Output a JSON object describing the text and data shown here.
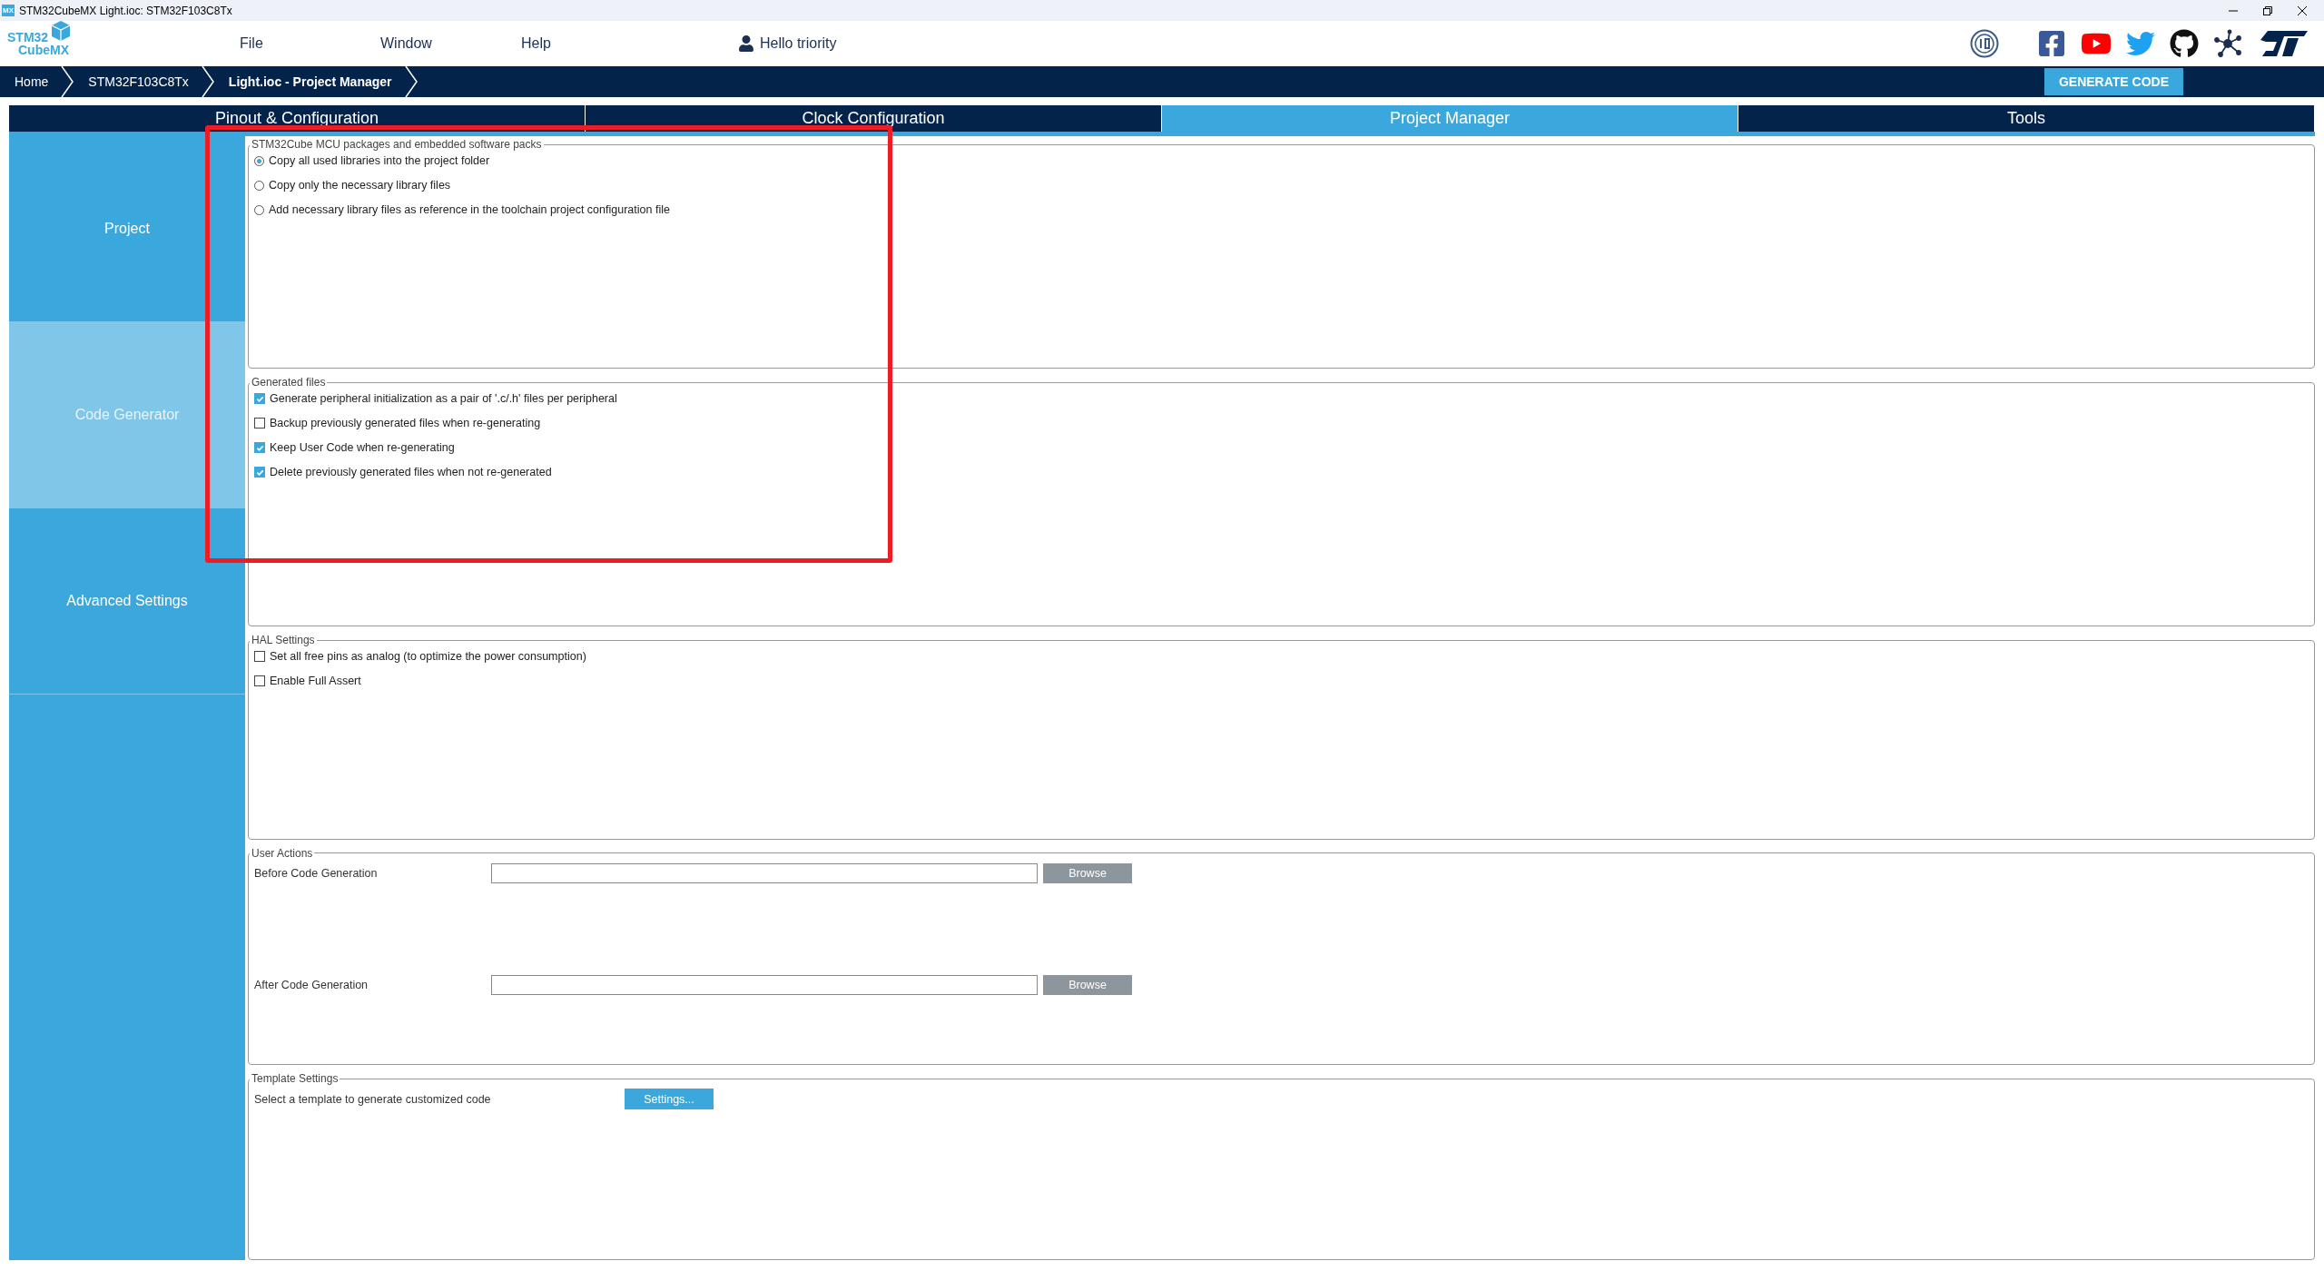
{
  "window": {
    "title": "STM32CubeMX Light.ioc: STM32F103C8Tx",
    "app_badge": "MX"
  },
  "logo": {
    "line1": "STM32",
    "line2": "CubeMX"
  },
  "menu": [
    {
      "label": "File"
    },
    {
      "label": "Window"
    },
    {
      "label": "Help"
    }
  ],
  "user": {
    "label": "Hello triority"
  },
  "breadcrumb": [
    {
      "label": "Home",
      "current": false
    },
    {
      "label": "STM32F103C8Tx",
      "current": false
    },
    {
      "label": "Light.ioc - Project Manager",
      "current": true
    }
  ],
  "generate_button": "GENERATE CODE",
  "tabs": [
    {
      "label": "Pinout & Configuration",
      "selected": false
    },
    {
      "label": "Clock Configuration",
      "selected": false
    },
    {
      "label": "Project Manager",
      "selected": true
    },
    {
      "label": "Tools",
      "selected": false
    }
  ],
  "sidebar": {
    "items": [
      {
        "label": "Project",
        "selected": false
      },
      {
        "label": "Code Generator",
        "selected": true
      },
      {
        "label": "Advanced Settings",
        "selected": false
      }
    ]
  },
  "sections": [
    {
      "title": "STM32Cube MCU packages and embedded software packs",
      "kind": "radio",
      "options": [
        {
          "label": "Copy all used libraries into the project folder",
          "selected": true
        },
        {
          "label": "Copy only the necessary library files",
          "selected": false
        },
        {
          "label": "Add necessary library files as reference in the toolchain project configuration file",
          "selected": false
        }
      ]
    },
    {
      "title": "Generated files",
      "kind": "checkbox",
      "options": [
        {
          "label": "Generate peripheral initialization as a pair of '.c/.h' files per peripheral",
          "checked": true
        },
        {
          "label": "Backup previously generated files when re-generating",
          "checked": false
        },
        {
          "label": "Keep User Code when re-generating",
          "checked": true
        },
        {
          "label": "Delete previously generated files when not re-generated",
          "checked": true
        }
      ]
    },
    {
      "title": "HAL Settings",
      "kind": "checkbox",
      "options": [
        {
          "label": "Set all free pins as analog (to optimize the power consumption)",
          "checked": false
        },
        {
          "label": "Enable Full Assert",
          "checked": false
        }
      ]
    },
    {
      "title": "User Actions",
      "kind": "actions",
      "actions": [
        {
          "label": "Before Code Generation",
          "button": "Browse"
        },
        {
          "label": "After Code Generation",
          "button": "Browse"
        }
      ]
    },
    {
      "title": "Template Settings",
      "kind": "template",
      "label": "Select a template to generate customized code",
      "button": "Settings..."
    }
  ]
}
